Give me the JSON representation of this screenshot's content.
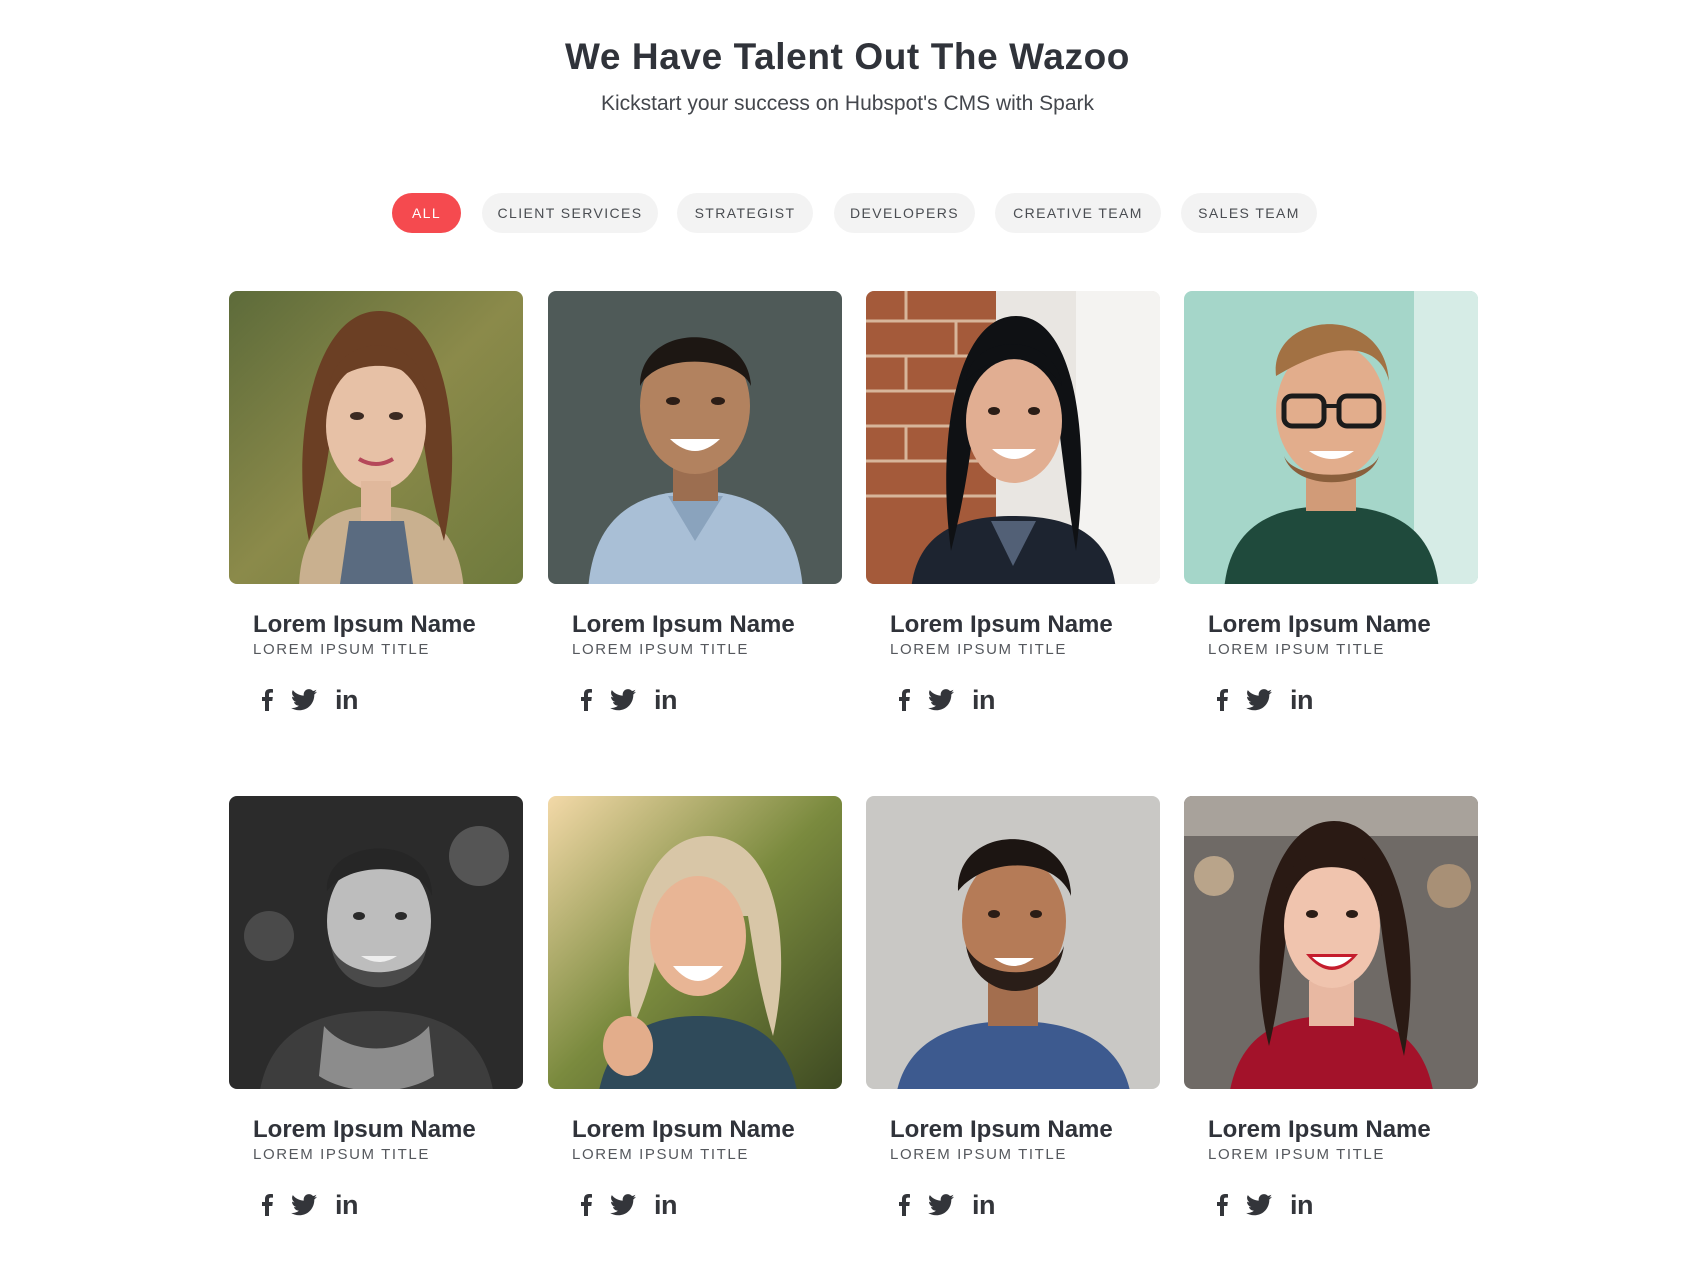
{
  "header": {
    "title": "We Have Talent Out The Wazoo",
    "subtitle": "Kickstart your success on Hubspot's CMS with Spark"
  },
  "filters": [
    {
      "label": "ALL",
      "active": true
    },
    {
      "label": "CLIENT SERVICES",
      "active": false
    },
    {
      "label": "STRATEGIST",
      "active": false
    },
    {
      "label": "DEVELOPERS",
      "active": false
    },
    {
      "label": "CREATIVE TEAM",
      "active": false
    },
    {
      "label": "SALES TEAM",
      "active": false
    }
  ],
  "team": [
    {
      "name": "Lorem Ipsum Name",
      "title": "LOREM IPSUM TITLE"
    },
    {
      "name": "Lorem Ipsum Name",
      "title": "LOREM IPSUM TITLE"
    },
    {
      "name": "Lorem Ipsum Name",
      "title": "LOREM IPSUM TITLE"
    },
    {
      "name": "Lorem Ipsum Name",
      "title": "LOREM IPSUM TITLE"
    },
    {
      "name": "Lorem Ipsum Name",
      "title": "LOREM IPSUM TITLE"
    },
    {
      "name": "Lorem Ipsum Name",
      "title": "LOREM IPSUM TITLE"
    },
    {
      "name": "Lorem Ipsum Name",
      "title": "LOREM IPSUM TITLE"
    },
    {
      "name": "Lorem Ipsum Name",
      "title": "LOREM IPSUM TITLE"
    }
  ],
  "social": {
    "facebook_icon": "facebook-icon",
    "twitter_icon": "twitter-icon",
    "linkedin_label": "in"
  },
  "colors": {
    "accent": "#f54a4f",
    "text": "#30333a",
    "pill_bg": "#f3f3f3"
  }
}
